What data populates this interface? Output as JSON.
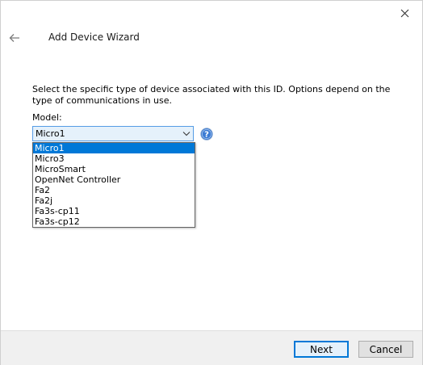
{
  "window": {
    "title": "Add Device Wizard"
  },
  "content": {
    "description": "Select the specific type of device associated with this ID. Options depend on the type of communications in use.",
    "model_label": "Model:",
    "model_select": {
      "value": "Micro1",
      "options": [
        "Micro1",
        "Micro3",
        "MicroSmart",
        "OpenNet Controller",
        "Fa2",
        "Fa2j",
        "Fa3s-cp11",
        "Fa3s-cp12"
      ],
      "selected_index": 0
    }
  },
  "footer": {
    "next_label": "Next",
    "cancel_label": "Cancel"
  },
  "icons": {
    "close": "close-icon",
    "back": "back-arrow-icon",
    "help": "help-icon",
    "dropdown": "chevron-down-icon"
  },
  "colors": {
    "accent": "#0078d7",
    "help_blue": "#3b7bd4",
    "combo_bg": "#e5f1fb",
    "footer_bg": "#f0f0f0"
  }
}
